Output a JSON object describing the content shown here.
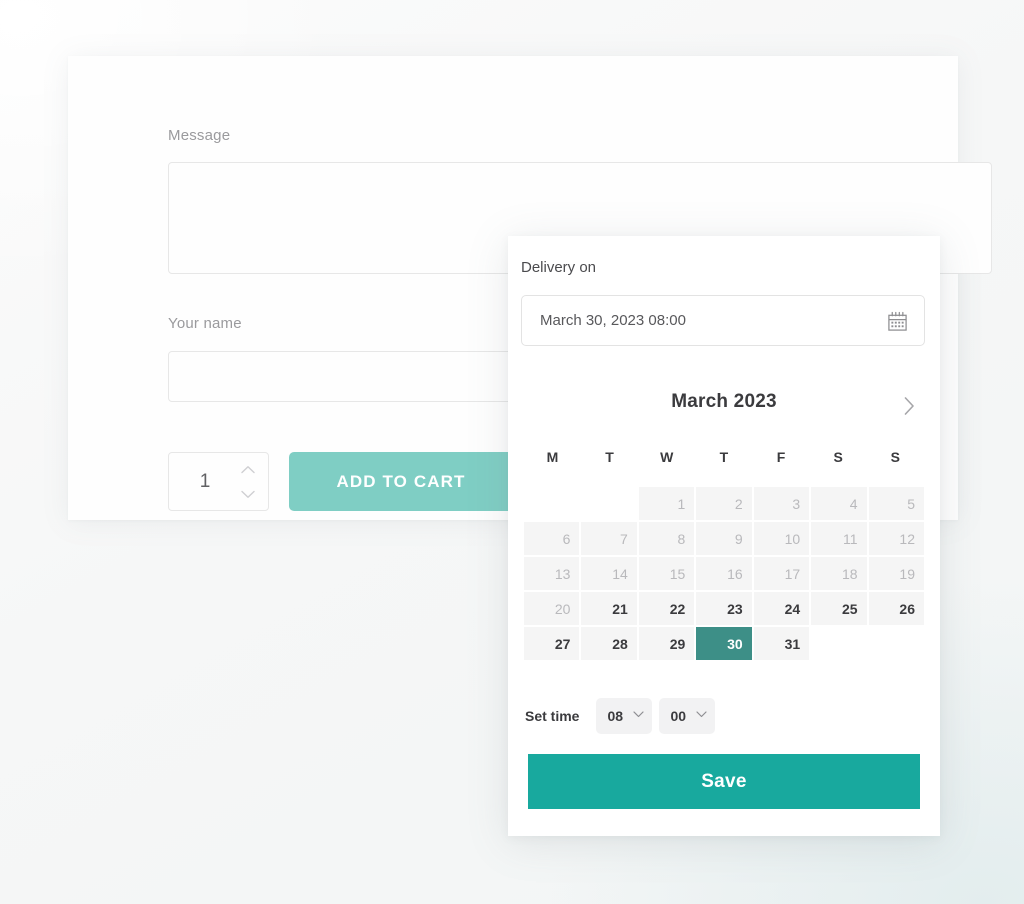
{
  "form": {
    "message_label": "Message",
    "message_value": "",
    "message_placeholder": "",
    "name_label": "Your name",
    "name_value": "",
    "name_placeholder": "",
    "quantity_value": "1",
    "add_to_cart_label": "ADD TO CART"
  },
  "datepicker": {
    "delivery_label": "Delivery on",
    "delivery_value": "March 30, 2023 08:00",
    "calendar_icon": "calendar-icon",
    "next_month_icon": "chevron-right-icon",
    "month_title": "March 2023",
    "weekdays": [
      "M",
      "T",
      "W",
      "T",
      "F",
      "S",
      "S"
    ],
    "leading_blanks": 2,
    "days": [
      {
        "n": "1",
        "state": "disabled"
      },
      {
        "n": "2",
        "state": "disabled"
      },
      {
        "n": "3",
        "state": "disabled"
      },
      {
        "n": "4",
        "state": "disabled"
      },
      {
        "n": "5",
        "state": "disabled"
      },
      {
        "n": "6",
        "state": "disabled"
      },
      {
        "n": "7",
        "state": "disabled"
      },
      {
        "n": "8",
        "state": "disabled"
      },
      {
        "n": "9",
        "state": "disabled"
      },
      {
        "n": "10",
        "state": "disabled"
      },
      {
        "n": "11",
        "state": "disabled"
      },
      {
        "n": "12",
        "state": "disabled"
      },
      {
        "n": "13",
        "state": "disabled"
      },
      {
        "n": "14",
        "state": "disabled"
      },
      {
        "n": "15",
        "state": "disabled"
      },
      {
        "n": "16",
        "state": "disabled"
      },
      {
        "n": "17",
        "state": "disabled"
      },
      {
        "n": "18",
        "state": "disabled"
      },
      {
        "n": "19",
        "state": "disabled"
      },
      {
        "n": "20",
        "state": "disabled"
      },
      {
        "n": "21",
        "state": "enabled"
      },
      {
        "n": "22",
        "state": "enabled"
      },
      {
        "n": "23",
        "state": "enabled"
      },
      {
        "n": "24",
        "state": "enabled"
      },
      {
        "n": "25",
        "state": "enabled"
      },
      {
        "n": "26",
        "state": "enabled"
      },
      {
        "n": "27",
        "state": "enabled"
      },
      {
        "n": "28",
        "state": "enabled"
      },
      {
        "n": "29",
        "state": "enabled"
      },
      {
        "n": "30",
        "state": "selected"
      },
      {
        "n": "31",
        "state": "enabled"
      }
    ],
    "set_time_label": "Set time",
    "hour_value": "08",
    "minute_value": "00",
    "caret_icon": "chevron-down-icon",
    "save_label": "Save"
  },
  "colors": {
    "accent_save": "#18a99e",
    "accent_selected_day": "#3d8f87",
    "accent_add_to_cart": "#7fcec4",
    "page_background": "#f6f7f7",
    "card_background": "#ffffff",
    "day_cell": "#f5f5f5",
    "text_dark": "#3b3b3e",
    "text_muted": "#9a9a9d",
    "text_disabled": "#b9b9bc"
  }
}
